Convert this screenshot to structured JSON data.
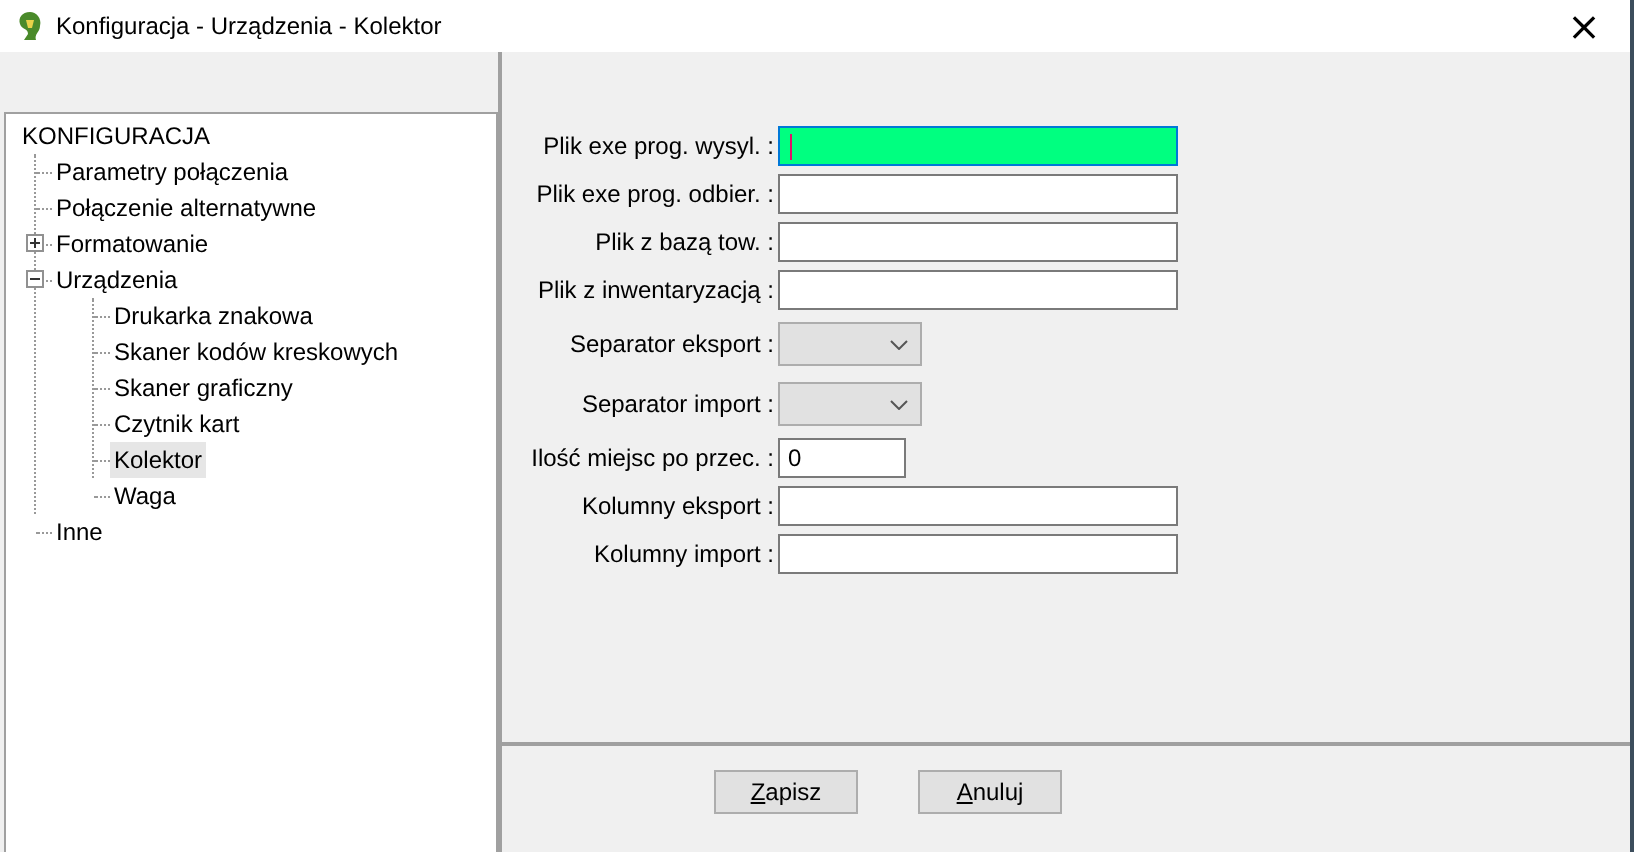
{
  "window": {
    "title": "Konfiguracja - Urządzenia - Kolektor",
    "close": "×"
  },
  "tree": {
    "label": "KONFIGURACJA",
    "children": [
      {
        "label": "Parametry połączenia",
        "selected": false
      },
      {
        "label": "Połączenie alternatywne",
        "selected": false
      },
      {
        "label": "Formatowanie",
        "selected": false,
        "expanded": false
      },
      {
        "label": "Urządzenia",
        "selected": false,
        "expanded": true,
        "children": [
          {
            "label": "Drukarka znakowa",
            "selected": false
          },
          {
            "label": "Skaner kodów kreskowych",
            "selected": false
          },
          {
            "label": "Skaner graficzny",
            "selected": false
          },
          {
            "label": "Czytnik kart",
            "selected": false
          },
          {
            "label": "Kolektor",
            "selected": true
          },
          {
            "label": "Waga",
            "selected": false
          }
        ]
      },
      {
        "label": "Inne",
        "selected": false
      }
    ]
  },
  "form": [
    {
      "kind": "text",
      "label": "Plik exe prog. wysyl. :",
      "focused": true
    },
    {
      "kind": "text",
      "label": "Plik exe prog. odbier. :",
      "focused": false
    },
    {
      "kind": "text",
      "label": "Plik z bazą tow. :",
      "focused": false
    },
    {
      "kind": "text",
      "label": "Plik z inwentaryzacją :",
      "focused": false
    },
    {
      "kind": "combo",
      "label": "Separator eksport :"
    },
    {
      "kind": "combo",
      "label": "Separator import :"
    },
    {
      "kind": "number",
      "label": "Ilość miejsc po przec. :",
      "value": "0",
      "focused": false
    },
    {
      "kind": "text",
      "label": "Kolumny eksport :",
      "focused": false
    },
    {
      "kind": "text",
      "label": "Kolumny import :",
      "focused": false
    }
  ],
  "buttons": [
    {
      "mnemonic": "Z",
      "rest": "apisz"
    },
    {
      "mnemonic": "A",
      "rest": "nuluj"
    }
  ]
}
